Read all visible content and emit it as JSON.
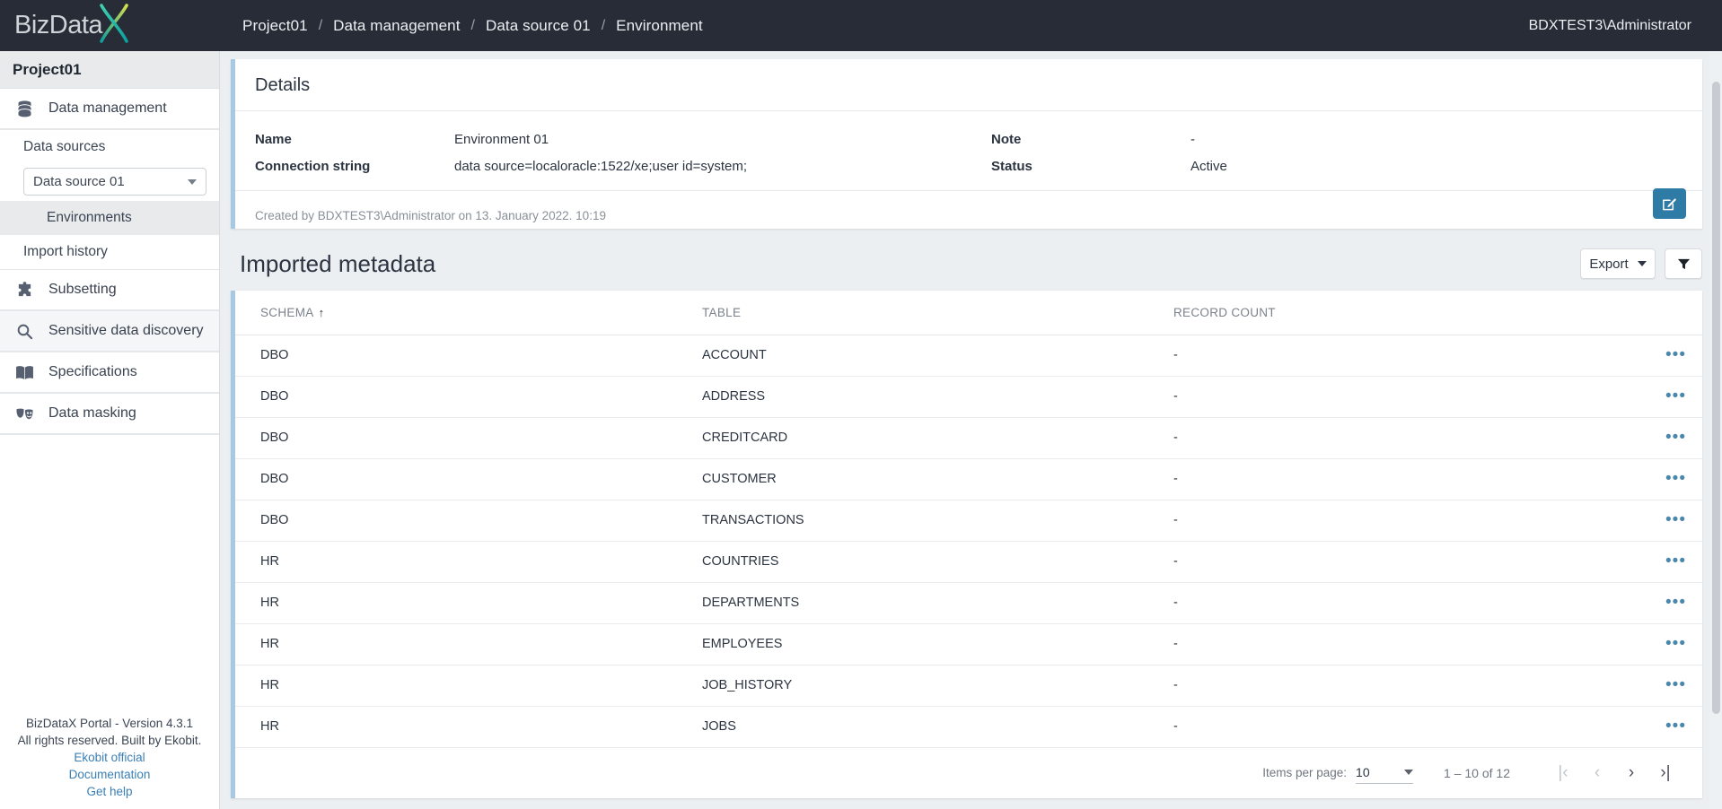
{
  "topbar": {
    "logo_text": "BizData",
    "logo_x": "X",
    "breadcrumb": [
      "Project01",
      "Data management",
      "Data source 01",
      "Environment"
    ],
    "separator": "/",
    "user": "BDXTEST3\\Administrator"
  },
  "sidebar": {
    "project": "Project01",
    "data_management": "Data management",
    "data_sources_label": "Data sources",
    "data_source_selected": "Data source 01",
    "environments": "Environments",
    "import_history": "Import history",
    "subsetting": "Subsetting",
    "sensitive_data_discovery": "Sensitive data discovery",
    "specifications": "Specifications",
    "data_masking": "Data masking",
    "footer": {
      "version": "BizDataX Portal - Version 4.3.1",
      "rights": "All rights reserved. Built by Ekobit.",
      "link_official": "Ekobit official",
      "link_docs": "Documentation",
      "link_help": "Get help"
    }
  },
  "details": {
    "title": "Details",
    "name_label": "Name",
    "name_value": "Environment 01",
    "connection_label": "Connection string",
    "connection_value": "data source=localoracle:1522/xe;user id=system;",
    "note_label": "Note",
    "note_value": "-",
    "status_label": "Status",
    "status_value": "Active",
    "created_by": "Created by BDXTEST3\\Administrator on 13. January 2022. 10:19"
  },
  "metadata": {
    "title": "Imported metadata",
    "export_label": "Export",
    "columns": [
      "SCHEMA",
      "TABLE",
      "RECORD COUNT"
    ],
    "sort_column": "SCHEMA",
    "sort_arrow": "↑",
    "rows": [
      {
        "schema": "DBO",
        "table": "ACCOUNT",
        "count": "-"
      },
      {
        "schema": "DBO",
        "table": "ADDRESS",
        "count": "-"
      },
      {
        "schema": "DBO",
        "table": "CREDITCARD",
        "count": "-"
      },
      {
        "schema": "DBO",
        "table": "CUSTOMER",
        "count": "-"
      },
      {
        "schema": "DBO",
        "table": "TRANSACTIONS",
        "count": "-"
      },
      {
        "schema": "HR",
        "table": "COUNTRIES",
        "count": "-"
      },
      {
        "schema": "HR",
        "table": "DEPARTMENTS",
        "count": "-"
      },
      {
        "schema": "HR",
        "table": "EMPLOYEES",
        "count": "-"
      },
      {
        "schema": "HR",
        "table": "JOB_HISTORY",
        "count": "-"
      },
      {
        "schema": "HR",
        "table": "JOBS",
        "count": "-"
      }
    ],
    "row_menu_glyph": "•••"
  },
  "paginator": {
    "items_per_page_label": "Items per page:",
    "items_per_page_value": "10",
    "range_label": "1 – 10 of 12",
    "first_glyph": "|‹",
    "prev_glyph": "‹",
    "next_glyph": "›",
    "last_glyph": "›|"
  },
  "colors": {
    "topbar_bg": "#272c36",
    "accent_blue": "#2e7ba6",
    "card_accent": "#a7c9e3",
    "link": "#3a7fb5",
    "dots": "#4a87ad"
  }
}
